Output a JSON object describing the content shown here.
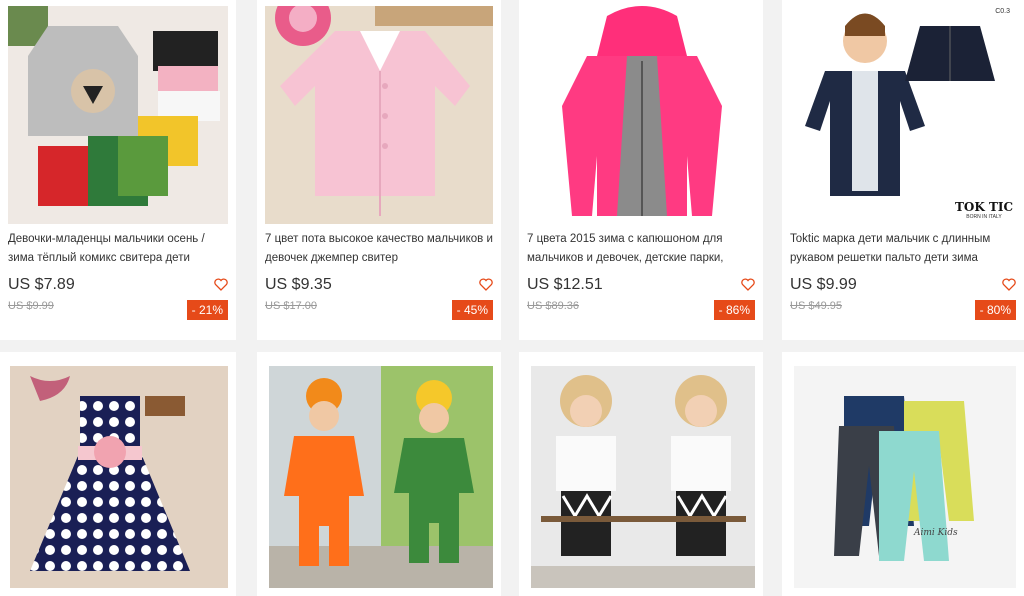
{
  "products": [
    {
      "title": "Девочки-младенцы мальчики осень / зима тёплый комикс свитера дети",
      "price": "US $7.89",
      "old_price": "US $9.99",
      "discount": "- 21%"
    },
    {
      "title": "7 цвет пота высокое качество мальчиков и девочек джемпер свитер",
      "price": "US $9.35",
      "old_price": "US $17.00",
      "discount": "- 45%"
    },
    {
      "title": "7 цвета 2015 зима с капюшоном для мальчиков и девочек, детские парки,",
      "price": "US $12.51",
      "old_price": "US $89.36",
      "discount": "- 86%"
    },
    {
      "title": "Toktic марка дети мальчик с длинным рукавом решетки пальто дети зима",
      "price": "US $9.99",
      "old_price": "US $49.95",
      "discount": "- 80%",
      "image_brand": "TOK TIC",
      "image_brand_sub": "BORN IN ITALY",
      "image_tag": "C0.3"
    }
  ],
  "row2_products": [
    {
      "name": "polka-dot-dress"
    },
    {
      "name": "frog-outfit"
    },
    {
      "name": "print-tshirt-set"
    },
    {
      "name": "harem-pants",
      "image_watermark": "Aimi Kids"
    }
  ],
  "colors": {
    "discount_bg": "#e64a19",
    "heart": "#e64a19",
    "page_bg": "#f2f2f2"
  }
}
